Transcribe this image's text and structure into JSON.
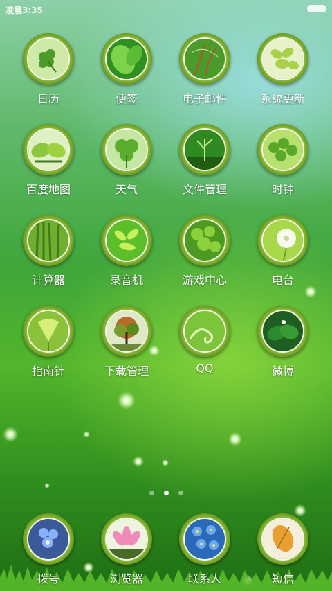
{
  "status_bar": {
    "time": "凌晨3:35"
  },
  "apps": [
    {
      "label": "日历",
      "icon": "clover-icon"
    },
    {
      "label": "便签",
      "icon": "leaf-icon"
    },
    {
      "label": "电子邮件",
      "icon": "plant-stem-icon"
    },
    {
      "label": "系统更新",
      "icon": "leaves-icon"
    },
    {
      "label": "百度地图",
      "icon": "leaf-icon"
    },
    {
      "label": "天气",
      "icon": "clover-icon"
    },
    {
      "label": "文件管理",
      "icon": "sprout-icon"
    },
    {
      "label": "时钟",
      "icon": "leaves-icon"
    },
    {
      "label": "计算器",
      "icon": "grass-icon"
    },
    {
      "label": "录音机",
      "icon": "leaves-icon"
    },
    {
      "label": "游戏中心",
      "icon": "leaves-icon"
    },
    {
      "label": "电台",
      "icon": "dandelion-icon"
    },
    {
      "label": "指南针",
      "icon": "ginkgo-leaf-icon"
    },
    {
      "label": "下载管理",
      "icon": "tree-icon"
    },
    {
      "label": "QQ",
      "icon": "tendril-icon"
    },
    {
      "label": "微博",
      "icon": "dark-leaf-icon"
    }
  ],
  "page_indicator": {
    "count": 3,
    "active": 2
  },
  "dock": [
    {
      "label": "拨号",
      "icon": "blue-flower-icon"
    },
    {
      "label": "浏览器",
      "icon": "lotus-icon"
    },
    {
      "label": "联系人",
      "icon": "forget-me-not-icon"
    },
    {
      "label": "短信",
      "icon": "autumn-leaf-icon"
    }
  ]
}
